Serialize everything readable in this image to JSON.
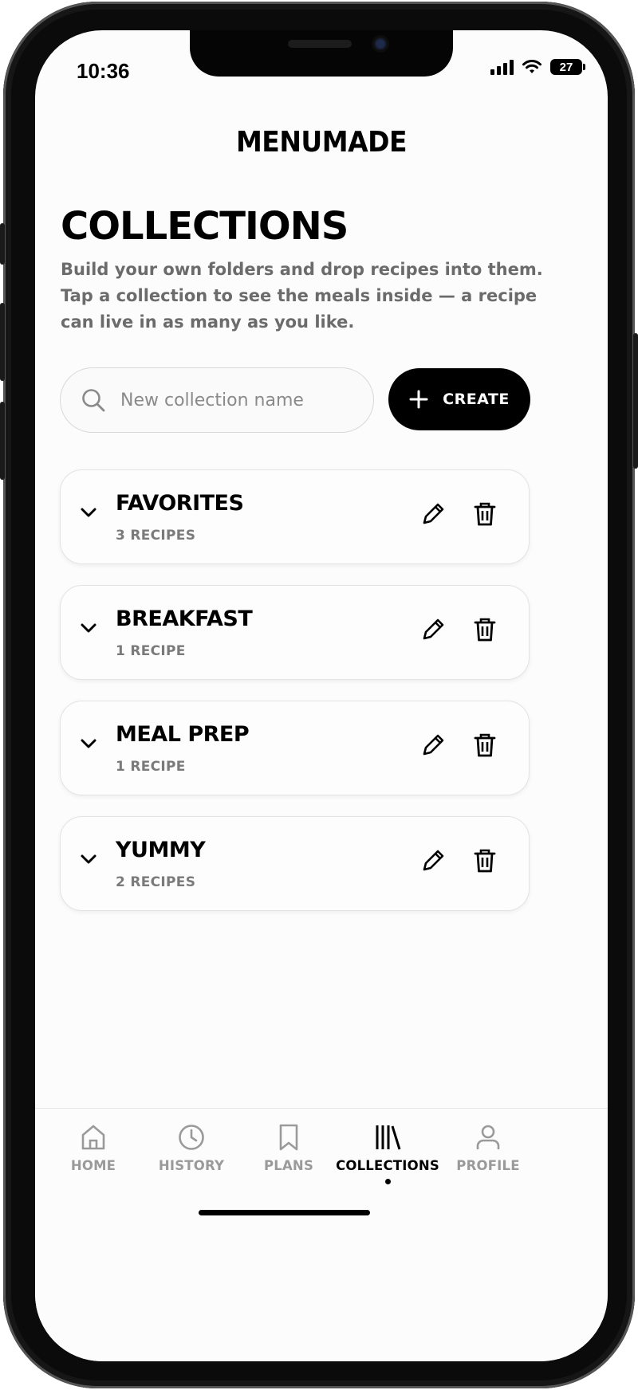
{
  "status_bar": {
    "time": "10:36",
    "battery": "27"
  },
  "app": {
    "brand": "MENUMADE"
  },
  "page": {
    "title": "COLLECTIONS",
    "description": "Build your own folders and drop recipes into them. Tap a collection to see the meals inside — a recipe can live in as many as you like."
  },
  "new_collection": {
    "placeholder": "New collection name",
    "value": "",
    "create_label": "CREATE"
  },
  "collections": [
    {
      "name": "FAVORITES",
      "count": "3 RECIPES"
    },
    {
      "name": "BREAKFAST",
      "count": "1 RECIPE"
    },
    {
      "name": "MEAL PREP",
      "count": "1 RECIPE"
    },
    {
      "name": "YUMMY",
      "count": "2 RECIPES"
    }
  ],
  "tab_bar": {
    "active": "COLLECTIONS",
    "items": [
      {
        "label": "HOME",
        "icon": "home-icon"
      },
      {
        "label": "HISTORY",
        "icon": "clock-icon"
      },
      {
        "label": "PLANS",
        "icon": "bookmark-icon"
      },
      {
        "label": "COLLECTIONS",
        "icon": "library-icon"
      },
      {
        "label": "PROFILE",
        "icon": "user-icon"
      }
    ]
  }
}
